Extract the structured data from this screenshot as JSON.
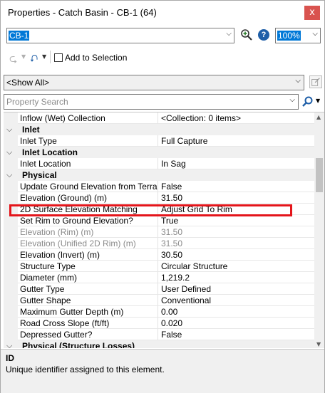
{
  "window": {
    "title": "Properties - Catch Basin - CB-1 (64)",
    "close_label": "x"
  },
  "element_selector": {
    "value": "CB-1"
  },
  "zoom": {
    "value": "100%"
  },
  "toolbar": {
    "add_to_selection_label": "Add to Selection",
    "add_to_selection_checked": false
  },
  "filter": {
    "value": "<Show All>"
  },
  "search": {
    "placeholder": "Property Search"
  },
  "grid": {
    "rows": [
      {
        "type": "prop",
        "name": "Inflow (Wet) Collection",
        "value": "<Collection: 0 items>"
      },
      {
        "type": "category",
        "label": "Inlet"
      },
      {
        "type": "prop",
        "name": "Inlet Type",
        "value": "Full Capture"
      },
      {
        "type": "category",
        "label": "Inlet Location"
      },
      {
        "type": "prop",
        "name": "Inlet Location",
        "value": "In Sag"
      },
      {
        "type": "category",
        "label": "Physical"
      },
      {
        "type": "prop",
        "name": "Update Ground Elevation from Terrain",
        "value": "False"
      },
      {
        "type": "prop",
        "name": "Elevation (Ground) (m)",
        "value": "31.50"
      },
      {
        "type": "prop",
        "name": "2D Surface Elevation Matching",
        "value": "Adjust Grid To Rim"
      },
      {
        "type": "prop",
        "name": "Set Rim to Ground Elevation?",
        "value": "True"
      },
      {
        "type": "prop",
        "name": "Elevation (Rim) (m)",
        "value": "31.50",
        "disabled": true
      },
      {
        "type": "prop",
        "name": "Elevation (Unified 2D Rim) (m)",
        "value": "31.50",
        "disabled": true
      },
      {
        "type": "prop",
        "name": "Elevation (Invert) (m)",
        "value": "30.50"
      },
      {
        "type": "prop",
        "name": "Structure Type",
        "value": "Circular Structure"
      },
      {
        "type": "prop",
        "name": "Diameter (mm)",
        "value": "1,219.2"
      },
      {
        "type": "prop",
        "name": "Gutter Type",
        "value": "User Defined"
      },
      {
        "type": "prop",
        "name": "Gutter Shape",
        "value": "Conventional"
      },
      {
        "type": "prop",
        "name": "Maximum Gutter Depth (m)",
        "value": "0.00"
      },
      {
        "type": "prop",
        "name": "Road Cross Slope (ft/ft)",
        "value": "0.020"
      },
      {
        "type": "prop",
        "name": "Depressed Gutter?",
        "value": "False"
      },
      {
        "type": "category",
        "label": "Physical (Structure Losses)"
      }
    ],
    "highlighted_row_name": "2D Surface Elevation Matching",
    "highlight_color": "#e4151b"
  },
  "description": {
    "title": "ID",
    "text": "Unique identifier assigned to this element."
  },
  "colors": {
    "selection_blue": "#0078d7",
    "category_bg": "#f0f0f0",
    "close_button": "#d9534f"
  }
}
